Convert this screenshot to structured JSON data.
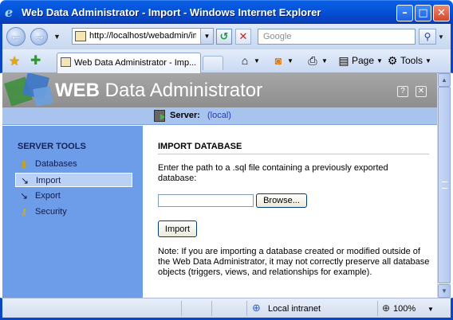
{
  "window": {
    "title": "Web Data Administrator - Import - Windows Internet Explorer"
  },
  "address": {
    "url": "http://localhost/webadmin/im",
    "search_placeholder": "Google"
  },
  "tabs": [
    {
      "label": "Web Data Administrator - Imp..."
    }
  ],
  "commands": {
    "page": "Page",
    "tools": "Tools"
  },
  "banner": {
    "brand_bold": "WEB",
    "brand_rest": " Data Administrator",
    "help_glyph": "?",
    "close_glyph": "✕"
  },
  "server": {
    "label": "Server:",
    "value": "(local)"
  },
  "sidebar": {
    "heading": "SERVER TOOLS",
    "items": [
      {
        "label": "Databases",
        "icon": "database-icon"
      },
      {
        "label": "Import",
        "icon": "import-icon"
      },
      {
        "label": "Export",
        "icon": "export-icon"
      },
      {
        "label": "Security",
        "icon": "key-icon"
      }
    ]
  },
  "main": {
    "heading": "IMPORT DATABASE",
    "instructions": "Enter the path to a .sql file containing a previously exported database:",
    "path_value": "",
    "browse_label": "Browse...",
    "import_label": "Import",
    "note": "Note: If you are importing a database created or modified outside of the Web Data Administrator, it may not correctly preserve all database objects (triggers, views, and relationships for example)."
  },
  "status": {
    "zone": "Local intranet",
    "zoom": "100%"
  },
  "colors": {
    "titlebar": "#0554da",
    "sidebar": "#6d9ce8",
    "server_bar": "#a8c4ee",
    "banner": "#999999"
  }
}
